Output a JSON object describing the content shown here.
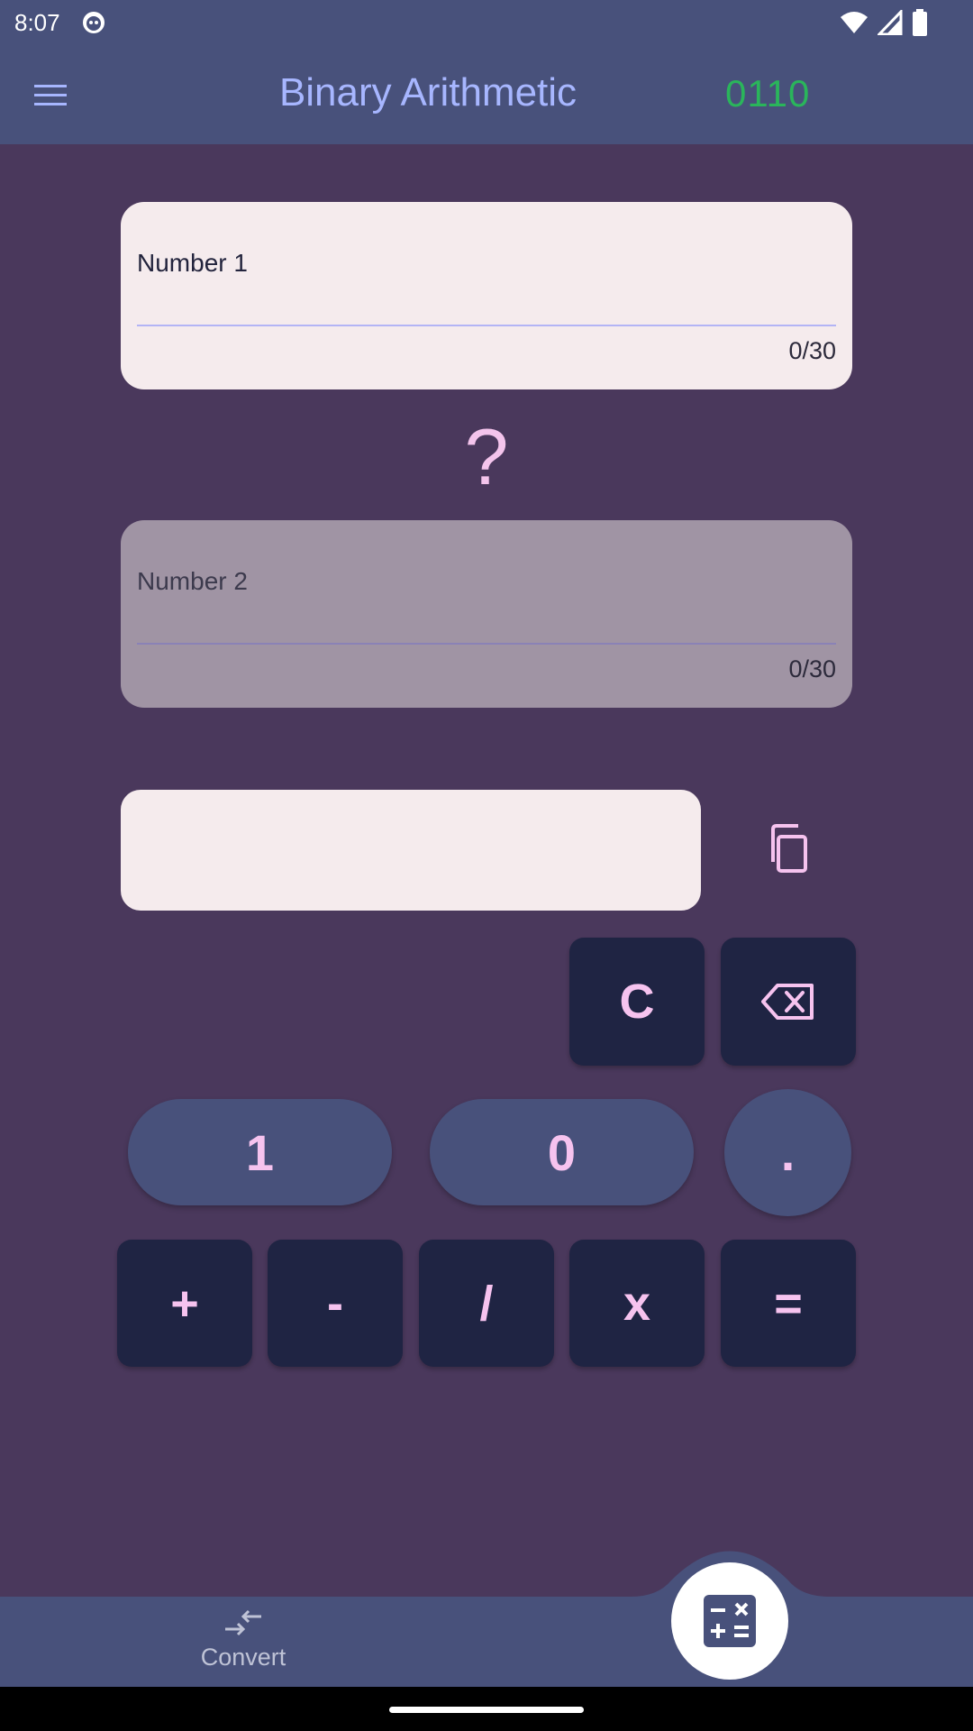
{
  "status_bar": {
    "time": "8:07"
  },
  "app_bar": {
    "title": "Binary Arithmetic",
    "logo_text": "0110"
  },
  "number1": {
    "label": "Number 1",
    "value": "",
    "counter": "0/30"
  },
  "operator_symbol": "?",
  "number2": {
    "label": "Number 2",
    "value": "",
    "counter": "0/30"
  },
  "result": {
    "value": ""
  },
  "keypad": {
    "clear": "C",
    "digit_one": "1",
    "digit_zero": "0",
    "decimal_point": ".",
    "add": "+",
    "subtract": "-",
    "divide": "/",
    "multiply": "x",
    "equals": "="
  },
  "bottom_nav": {
    "convert_label": "Convert"
  },
  "icons": {
    "menu": "menu-icon",
    "copy": "copy-icon",
    "backspace": "backspace-icon",
    "convert": "convert-icon",
    "calculator": "calculator-icon",
    "wifi": "wifi-icon",
    "signal": "signal-icon",
    "battery": "battery-icon"
  },
  "colors": {
    "background": "#4a385c",
    "app_bar": "#48517b",
    "title": "#a7b6ff",
    "logo": "#2ab55b",
    "key": "#1f2443",
    "key_text": "#f6c3ef",
    "field": "#f5ebed",
    "field_disabled": "#a094a4"
  }
}
